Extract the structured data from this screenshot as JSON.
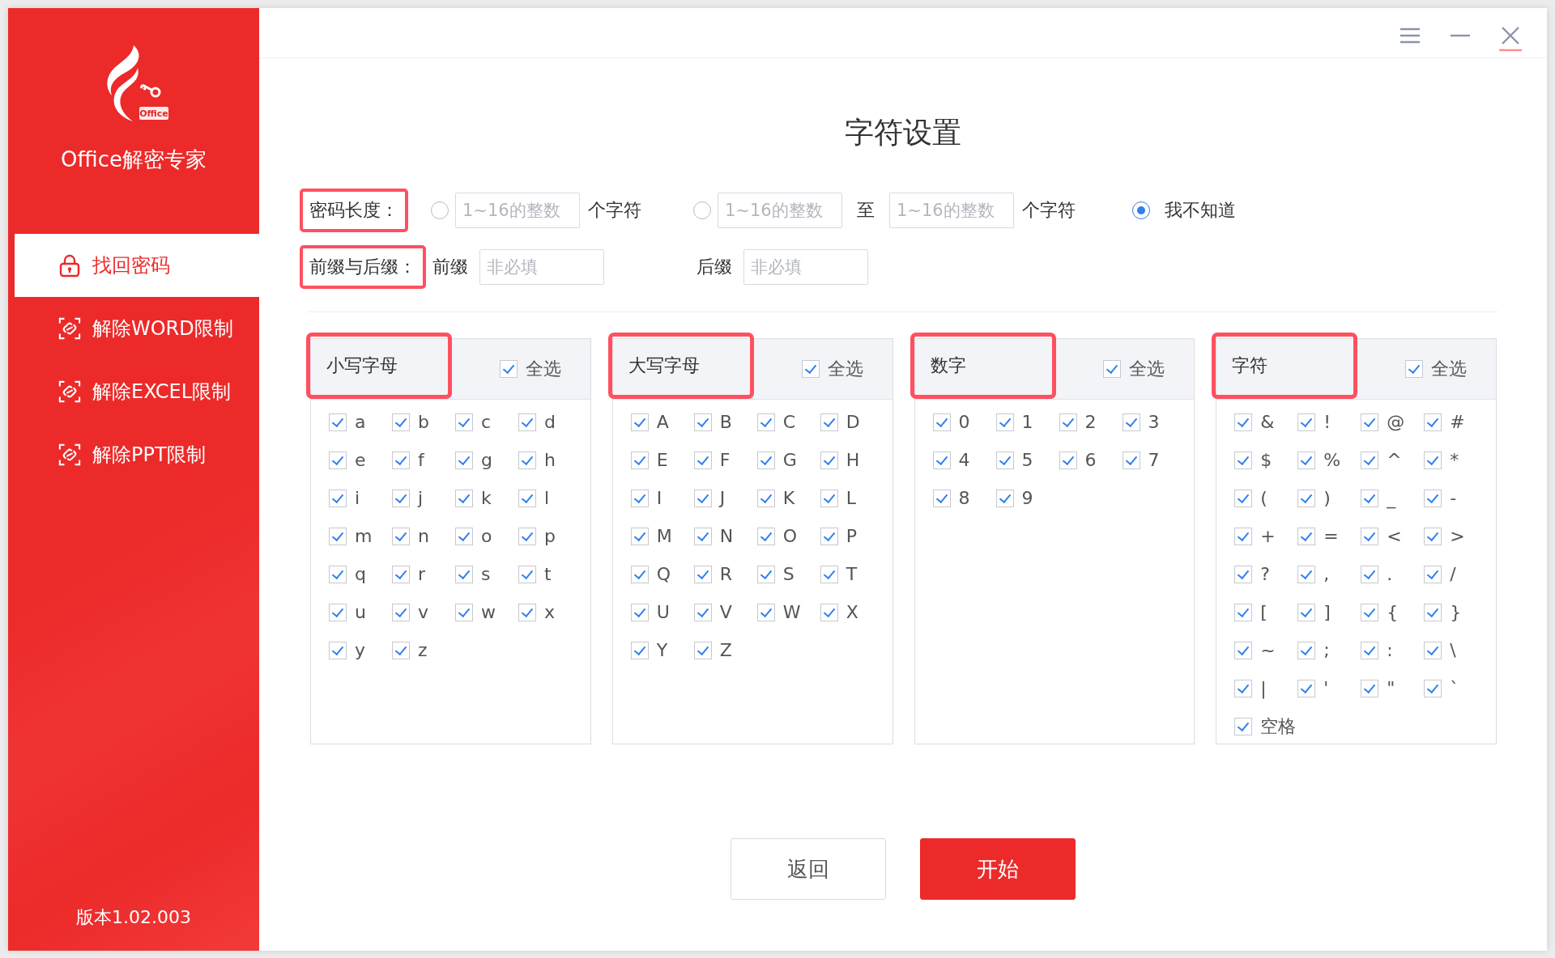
{
  "app": {
    "name": "Office解密专家",
    "logo_badge": "Office",
    "version": "版本1.02.003"
  },
  "sidebar": {
    "items": [
      {
        "label": "找回密码",
        "kind": "lock",
        "selected": true
      },
      {
        "label": "解除WORD限制",
        "kind": "unlink",
        "selected": false
      },
      {
        "label": "解除EXCEL限制",
        "kind": "unlink",
        "selected": false
      },
      {
        "label": "解除PPT限制",
        "kind": "unlink",
        "selected": false
      }
    ]
  },
  "page_title": "字符设置",
  "password_length": {
    "label": "密码长度：",
    "highlighted": true,
    "options": [
      {
        "kind": "fixed",
        "selected": false,
        "field": {
          "placeholder": "1~16的整数"
        },
        "unit": "个字符"
      },
      {
        "kind": "range",
        "selected": false,
        "from": {
          "placeholder": "1~16的整数"
        },
        "to_label": "至",
        "to": {
          "placeholder": "1~16的整数"
        },
        "unit": "个字符"
      },
      {
        "kind": "unknown",
        "selected": true,
        "label": "我不知道"
      }
    ]
  },
  "affix": {
    "label": "前缀与后缀：",
    "highlighted": true,
    "fields": [
      {
        "label": "前缀",
        "placeholder": "非必填"
      },
      {
        "label": "后缀",
        "placeholder": "非必填"
      }
    ]
  },
  "charsets": [
    {
      "title": "小写字母",
      "highlighted": true,
      "select_all": {
        "label": "全选",
        "checked": true
      },
      "chars": [
        {
          "label": "a",
          "checked": true
        },
        {
          "label": "b",
          "checked": true
        },
        {
          "label": "c",
          "checked": true
        },
        {
          "label": "d",
          "checked": true
        },
        {
          "label": "e",
          "checked": true
        },
        {
          "label": "f",
          "checked": true
        },
        {
          "label": "g",
          "checked": true
        },
        {
          "label": "h",
          "checked": true
        },
        {
          "label": "i",
          "checked": true
        },
        {
          "label": "j",
          "checked": true
        },
        {
          "label": "k",
          "checked": true
        },
        {
          "label": "l",
          "checked": true
        },
        {
          "label": "m",
          "checked": true
        },
        {
          "label": "n",
          "checked": true
        },
        {
          "label": "o",
          "checked": true
        },
        {
          "label": "p",
          "checked": true
        },
        {
          "label": "q",
          "checked": true
        },
        {
          "label": "r",
          "checked": true
        },
        {
          "label": "s",
          "checked": true
        },
        {
          "label": "t",
          "checked": true
        },
        {
          "label": "u",
          "checked": true
        },
        {
          "label": "v",
          "checked": true
        },
        {
          "label": "w",
          "checked": true
        },
        {
          "label": "x",
          "checked": true
        },
        {
          "label": "y",
          "checked": true
        },
        {
          "label": "z",
          "checked": true
        }
      ]
    },
    {
      "title": "大写字母",
      "highlighted": true,
      "select_all": {
        "label": "全选",
        "checked": true
      },
      "chars": [
        {
          "label": "A",
          "checked": true
        },
        {
          "label": "B",
          "checked": true
        },
        {
          "label": "C",
          "checked": true
        },
        {
          "label": "D",
          "checked": true
        },
        {
          "label": "E",
          "checked": true
        },
        {
          "label": "F",
          "checked": true
        },
        {
          "label": "G",
          "checked": true
        },
        {
          "label": "H",
          "checked": true
        },
        {
          "label": "I",
          "checked": true
        },
        {
          "label": "J",
          "checked": true
        },
        {
          "label": "K",
          "checked": true
        },
        {
          "label": "L",
          "checked": true
        },
        {
          "label": "M",
          "checked": true
        },
        {
          "label": "N",
          "checked": true
        },
        {
          "label": "O",
          "checked": true
        },
        {
          "label": "P",
          "checked": true
        },
        {
          "label": "Q",
          "checked": true
        },
        {
          "label": "R",
          "checked": true
        },
        {
          "label": "S",
          "checked": true
        },
        {
          "label": "T",
          "checked": true
        },
        {
          "label": "U",
          "checked": true
        },
        {
          "label": "V",
          "checked": true
        },
        {
          "label": "W",
          "checked": true
        },
        {
          "label": "X",
          "checked": true
        },
        {
          "label": "Y",
          "checked": true
        },
        {
          "label": "Z",
          "checked": true
        }
      ]
    },
    {
      "title": "数字",
      "highlighted": true,
      "select_all": {
        "label": "全选",
        "checked": true
      },
      "chars": [
        {
          "label": "0",
          "checked": true
        },
        {
          "label": "1",
          "checked": true
        },
        {
          "label": "2",
          "checked": true
        },
        {
          "label": "3",
          "checked": true
        },
        {
          "label": "4",
          "checked": true
        },
        {
          "label": "5",
          "checked": true
        },
        {
          "label": "6",
          "checked": true
        },
        {
          "label": "7",
          "checked": true
        },
        {
          "label": "8",
          "checked": true
        },
        {
          "label": "9",
          "checked": true
        }
      ]
    },
    {
      "title": "字符",
      "highlighted": true,
      "select_all": {
        "label": "全选",
        "checked": true
      },
      "chars": [
        {
          "label": "&",
          "checked": true
        },
        {
          "label": "!",
          "checked": true
        },
        {
          "label": "@",
          "checked": true
        },
        {
          "label": "#",
          "checked": true
        },
        {
          "label": "$",
          "checked": true
        },
        {
          "label": "%",
          "checked": true
        },
        {
          "label": "^",
          "checked": true
        },
        {
          "label": "*",
          "checked": true
        },
        {
          "label": "(",
          "checked": true
        },
        {
          "label": ")",
          "checked": true
        },
        {
          "label": "_",
          "checked": true
        },
        {
          "label": "-",
          "checked": true
        },
        {
          "label": "+",
          "checked": true
        },
        {
          "label": "=",
          "checked": true
        },
        {
          "label": "<",
          "checked": true
        },
        {
          "label": ">",
          "checked": true
        },
        {
          "label": "?",
          "checked": true
        },
        {
          "label": ",",
          "checked": true
        },
        {
          "label": ".",
          "checked": true
        },
        {
          "label": "/",
          "checked": true
        },
        {
          "label": "[",
          "checked": true
        },
        {
          "label": "]",
          "checked": true
        },
        {
          "label": "{",
          "checked": true
        },
        {
          "label": "}",
          "checked": true
        },
        {
          "label": "~",
          "checked": true
        },
        {
          "label": ";",
          "checked": true
        },
        {
          "label": ":",
          "checked": true
        },
        {
          "label": "\\",
          "checked": true
        },
        {
          "label": "|",
          "checked": true
        },
        {
          "label": "'",
          "checked": true
        },
        {
          "label": "\"",
          "checked": true
        },
        {
          "label": "`",
          "checked": true
        },
        {
          "label": "空格",
          "checked": true
        }
      ]
    }
  ],
  "buttons": [
    {
      "label": "返回",
      "kind": "secondary"
    },
    {
      "label": "开始",
      "kind": "primary"
    }
  ]
}
